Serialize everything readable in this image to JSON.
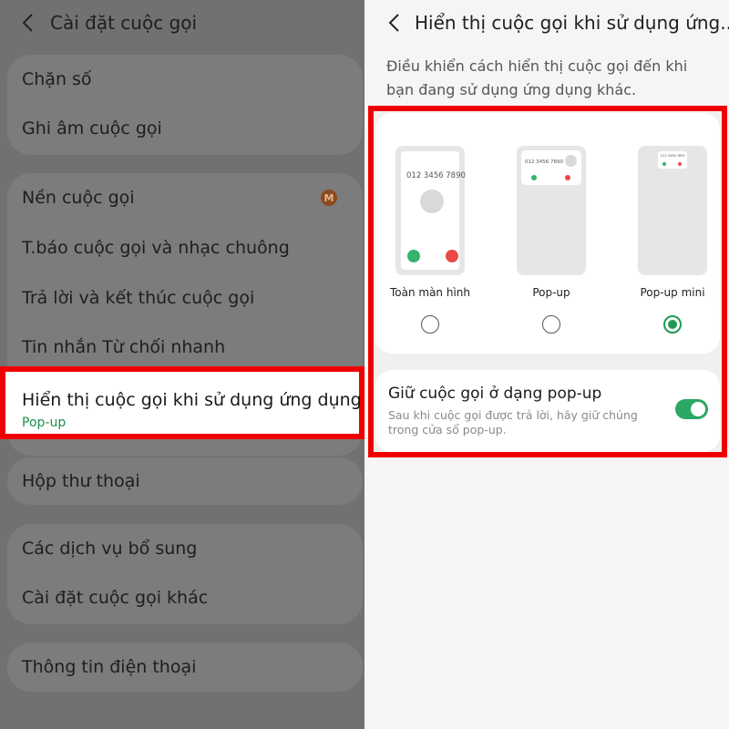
{
  "left": {
    "title": "Cài đặt cuộc gọi",
    "groups": [
      [
        "Chặn số",
        "Ghi âm cuộc gọi"
      ],
      [
        "Nền cuộc gọi",
        "T.báo cuộc gọi và nhạc chuông",
        "Trả lời và kết thúc cuộc gọi",
        "Tin nhắn Từ chối nhanh"
      ],
      [
        "Hộp thư thoại"
      ],
      [
        "Các dịch vụ bổ sung",
        "Cài đặt cuộc gọi khác"
      ],
      [
        "Thông tin điện thoại"
      ]
    ],
    "badge": "M",
    "highlighted": {
      "title": "Hiển thị cuộc gọi khi sử dụng ứng dụng",
      "subtitle": "Pop-up"
    }
  },
  "right": {
    "title": "Hiển thị cuộc gọi khi sử dụng ứng...",
    "description": "Điều khiển cách hiển thị cuộc gọi đến khi bạn đang sử dụng ứng dụng khác.",
    "options": [
      {
        "label": "Toàn màn hình",
        "number": "012 3456 7890",
        "selected": false
      },
      {
        "label": "Pop-up",
        "number": "012 3456 7890",
        "selected": false
      },
      {
        "label": "Pop-up mini",
        "number": "012 3456 7890",
        "selected": true
      }
    ],
    "keep": {
      "title": "Giữ cuộc gọi ở dạng pop-up",
      "subtitle": "Sau khi cuộc gọi được trả lời, hãy giữ chúng trong cửa sổ pop-up.",
      "enabled": true
    }
  },
  "colors": {
    "accent_green": "#1f9a57",
    "highlight_red": "#ee0000",
    "badge_bg": "#8b4a1e"
  }
}
